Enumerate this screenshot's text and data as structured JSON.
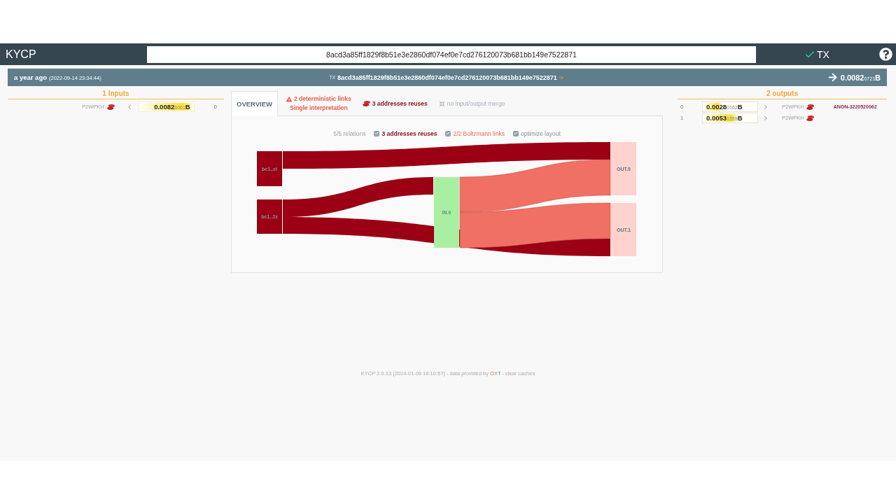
{
  "header": {
    "brand": "KYCP",
    "search_value": "8acd3a85ff1829f8b51e3e2860df074ef0e7cd276120073b681bb149e7522871",
    "mode": "TX"
  },
  "tx_bar": {
    "age": "a year ago",
    "date": "(2022-09-14 23:34:44)",
    "tx_label": "TX",
    "txid": "8acd3a85ff1829f8b51e3e2860df074ef0e7cd276120073b681bb149e7522871",
    "amount": "0.0082",
    "amount_small": "0721",
    "unit": "B"
  },
  "inputs": {
    "title": "1 Inputs",
    "rows": [
      {
        "index": "0",
        "script": "P2WPKH",
        "amount": "0.0082",
        "amount_small": "6061",
        "unit": "B",
        "level": 1
      }
    ]
  },
  "tabs": [
    {
      "kind": "overview",
      "label": "OVERVIEW",
      "selected": true
    },
    {
      "kind": "warning",
      "label": "2 deterministic links",
      "sublabel": "Single interpretation",
      "selected": false
    },
    {
      "kind": "reuse",
      "label": "3 addresses reuses",
      "selected": false
    },
    {
      "kind": "merge",
      "label": "no input/output merge",
      "selected": false
    }
  ],
  "overview": {
    "summary": "5/5 relations",
    "options": [
      {
        "kind": "reuse",
        "label": "3 addresses reuses",
        "checked": true
      },
      {
        "kind": "boltzmann",
        "label": "2/2 Boltzmann links",
        "checked": true
      },
      {
        "kind": "layout",
        "label": "optimize layout",
        "checked": true
      }
    ],
    "diagram": {
      "addresses": [
        {
          "label": "bc1..cl"
        },
        {
          "label": "bc1..2z"
        }
      ],
      "inputs": [
        {
          "label": "IN.0"
        }
      ],
      "outputs": [
        {
          "label": "OUT.0"
        },
        {
          "label": "OUT.1"
        }
      ],
      "links": [
        {
          "kind": "reuse"
        },
        {
          "kind": "reuse"
        },
        {
          "kind": "reuse"
        },
        {
          "kind": "boltzmann"
        },
        {
          "kind": "boltzmann"
        }
      ]
    }
  },
  "outputs": {
    "title": "2 outputs",
    "rows": [
      {
        "index": "0",
        "amount": "0.0028",
        "amount_small": "0162",
        "unit": "B",
        "level": 0.34,
        "script": "P2WPKH",
        "tag": "ANON-3220520062"
      },
      {
        "index": "1",
        "amount": "0.0053",
        "amount_small": "1559",
        "unit": "B",
        "level": 0.65,
        "script": "P2WPKH"
      }
    ]
  },
  "footer": {
    "text": "KYCP 2.0.13 (2024-01-09 18:10:57) - data provided by",
    "source": "OXT",
    "separator": "-",
    "action": "clear caches"
  }
}
